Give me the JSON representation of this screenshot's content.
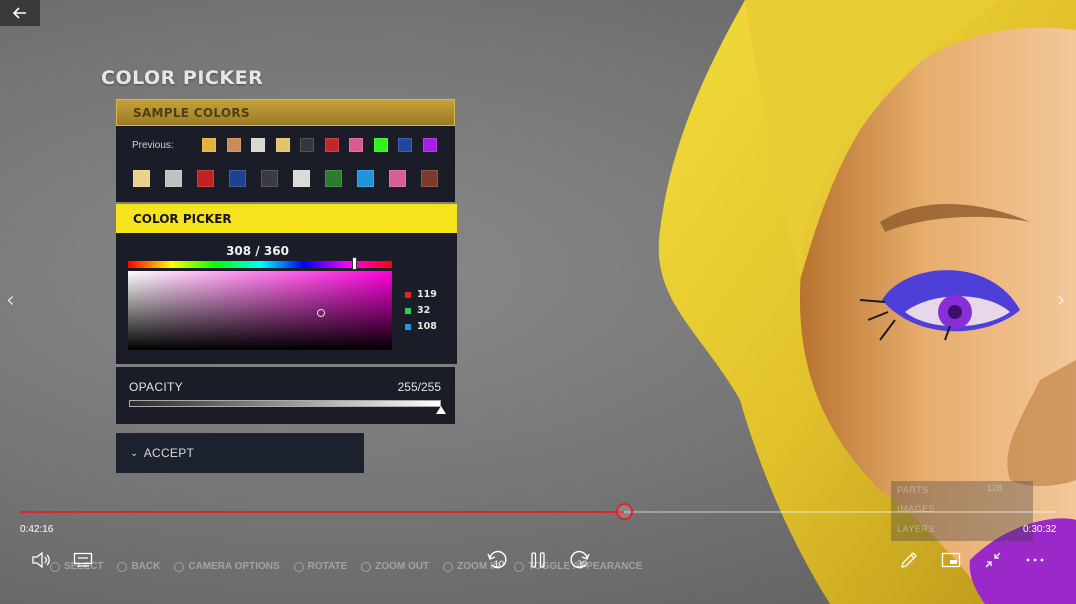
{
  "game_ui": {
    "title": "COLOR PICKER",
    "sample_colors": {
      "header": "SAMPLE COLORS",
      "previous_label": "Previous:",
      "previous_swatches": [
        "#e2b33a",
        "#c98b5a",
        "#d8d8d0",
        "#e3c36c",
        "#35363a",
        "#c1262b",
        "#d85b90",
        "#2ff21c",
        "#20479c",
        "#a41ee3"
      ],
      "palette_swatches": [
        "#ecd08e",
        "#c0c2c0",
        "#c0221f",
        "#1f4191",
        "#3b3b3f",
        "#dcdcd6",
        "#2c7a2e",
        "#1f94dc",
        "#d75e96",
        "#7a3a2c"
      ]
    },
    "color_picker": {
      "header": "COLOR PICKER",
      "hue_label": "308 / 360",
      "hue": 308,
      "hue_max": 360,
      "saturation": 0.73,
      "brightness": 0.47,
      "red": "119",
      "green": "32",
      "blue": "108",
      "red_color": "#e0242b",
      "green_color": "#22d25a",
      "blue_color": "#1f9be6"
    },
    "opacity": {
      "label": "OPACITY",
      "value": "255/255",
      "fraction": 1.0
    },
    "accept": {
      "key_icon": "dpad-down-icon",
      "label": "ACCEPT"
    },
    "stats": [
      {
        "label": "PARTS",
        "value": "128"
      },
      {
        "label": "IMAGES",
        "value": ""
      },
      {
        "label": "LAYERS",
        "value": ""
      }
    ],
    "hints": [
      "SELECT",
      "BACK",
      "CAMERA OPTIONS",
      "ROTATE",
      "ZOOM OUT",
      "ZOOM IN",
      "TOGGLE APPEARANCE"
    ]
  },
  "player": {
    "time_elapsed": "0:42:16",
    "time_remaining": "0:30:32",
    "progress": 0.583,
    "accent_color": "#e4222b",
    "skip_back_seconds": "10",
    "skip_forward_seconds": "30"
  }
}
